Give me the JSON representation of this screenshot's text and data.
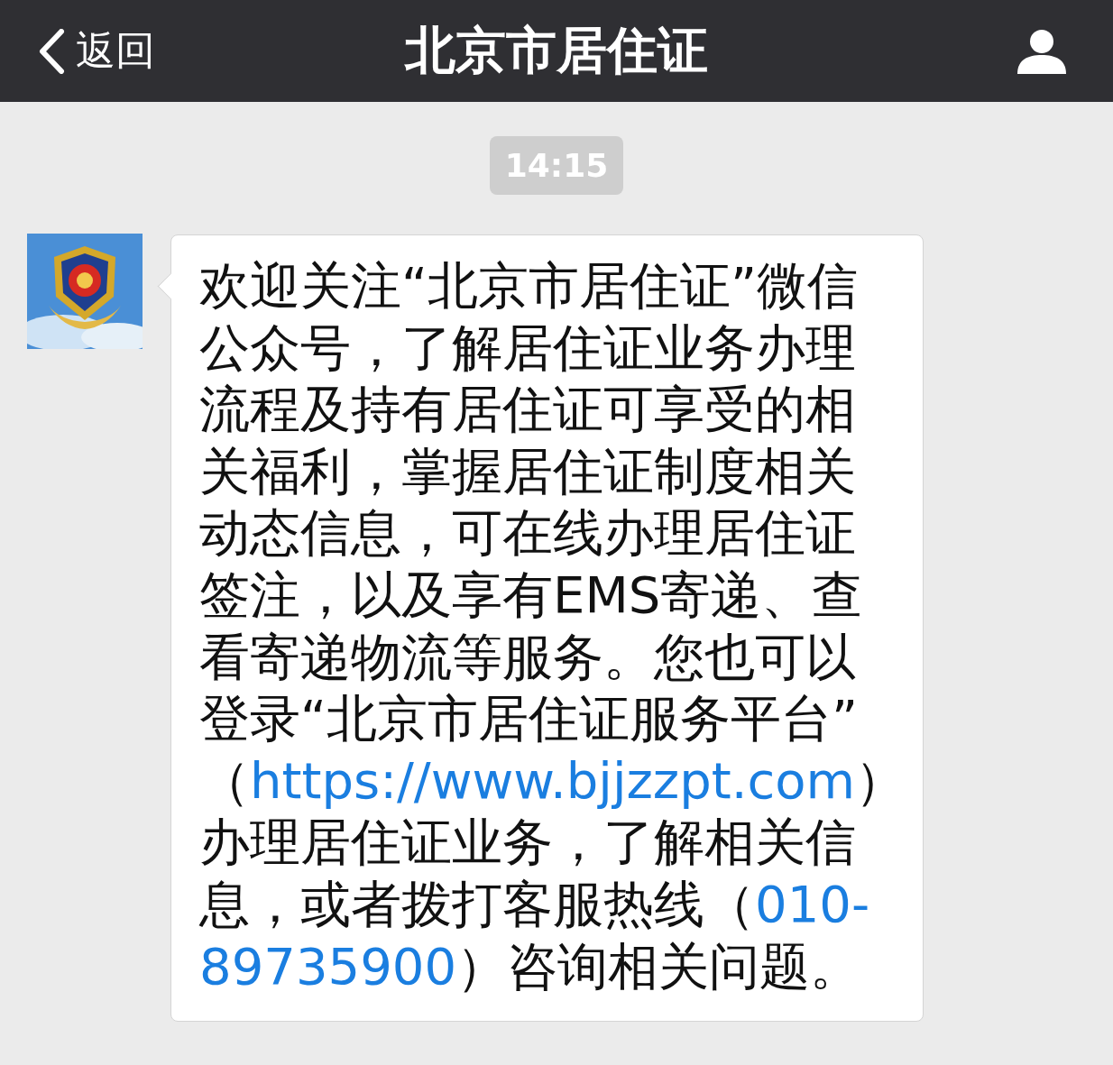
{
  "header": {
    "back_label": "返回",
    "title": "北京市居住证"
  },
  "timestamp": "14:15",
  "message": {
    "lines": [
      [
        {
          "kind": "text",
          "text": "欢迎关注“北京市居住证”微信"
        }
      ],
      [
        {
          "kind": "text",
          "text": "公众号，了解居住证业务办理"
        }
      ],
      [
        {
          "kind": "text",
          "text": "流程及持有居住证可享受的相"
        }
      ],
      [
        {
          "kind": "text",
          "text": "关福利，掌握居住证制度相关"
        }
      ],
      [
        {
          "kind": "text",
          "text": "动态信息，可在线办理居住证"
        }
      ],
      [
        {
          "kind": "text",
          "text": "签注，以及享有EMS寄递、查"
        }
      ],
      [
        {
          "kind": "text",
          "text": "看寄递物流等服务。您也可以"
        }
      ],
      [
        {
          "kind": "text",
          "text": "登录“北京市居住证服务平台”"
        }
      ],
      [
        {
          "kind": "text",
          "text": "（"
        },
        {
          "kind": "link",
          "text": "https://www.bjjzzpt.com"
        },
        {
          "kind": "text",
          "text": "）"
        }
      ],
      [
        {
          "kind": "text",
          "text": "办理居住证业务，了解相关信"
        }
      ],
      [
        {
          "kind": "text",
          "text": "息，或者拨打客服热线（"
        },
        {
          "kind": "link",
          "text": "010-"
        }
      ],
      [
        {
          "kind": "link",
          "text": "89735900"
        },
        {
          "kind": "text",
          "text": "）咨询相关问题。"
        }
      ]
    ]
  }
}
